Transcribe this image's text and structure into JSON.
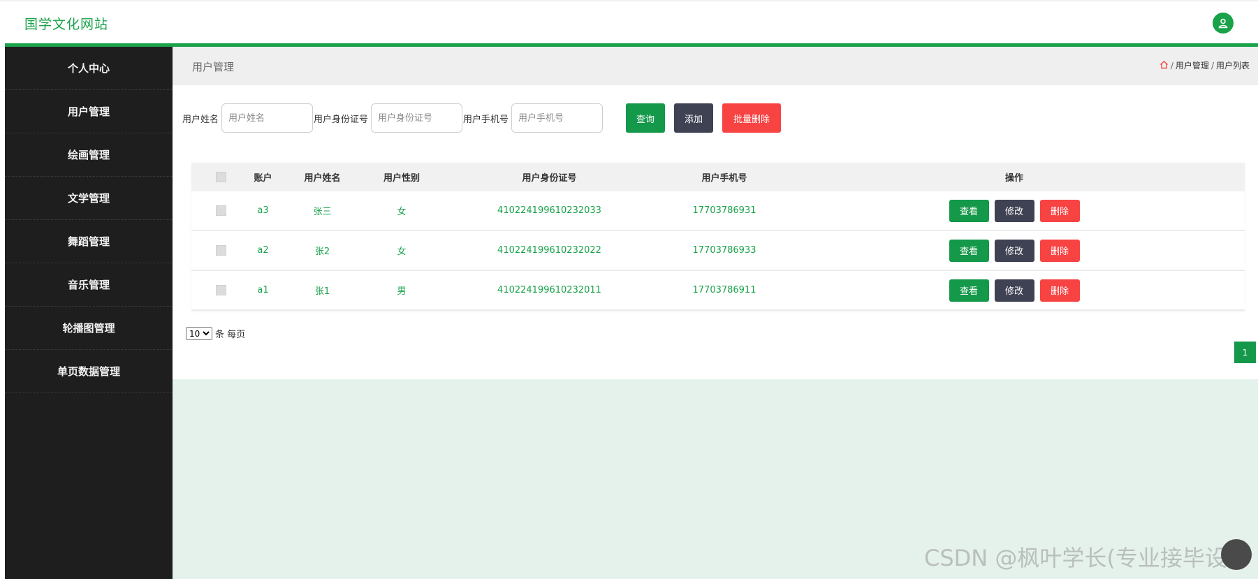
{
  "app": {
    "title": "国学文化网站"
  },
  "colors": {
    "accent": "#19a24a",
    "sidebar": "#1e1e1e",
    "danger": "#f74342",
    "dark": "#3e4253"
  },
  "sidebar": {
    "items": [
      {
        "label": "个人中心"
      },
      {
        "label": "用户管理"
      },
      {
        "label": "绘画管理"
      },
      {
        "label": "文学管理"
      },
      {
        "label": "舞蹈管理"
      },
      {
        "label": "音乐管理"
      },
      {
        "label": "轮播图管理"
      },
      {
        "label": "单页数据管理"
      }
    ]
  },
  "page": {
    "title": "用户管理",
    "breadcrumb": {
      "home_icon": "home-icon",
      "sep": "/",
      "level1": "用户管理",
      "level2": "用户列表"
    }
  },
  "search": {
    "name_label": "用户姓名",
    "name_placeholder": "用户姓名",
    "id_label": "用户身份证号",
    "id_placeholder": "用户身份证号",
    "phone_label": "用户手机号",
    "phone_placeholder": "用户手机号",
    "query_label": "查询",
    "add_label": "添加",
    "batch_delete_label": "批量删除"
  },
  "table": {
    "headers": {
      "account": "账户",
      "name": "用户姓名",
      "sex": "用户性别",
      "id": "用户身份证号",
      "phone": "用户手机号",
      "ops": "操作"
    },
    "rows": [
      {
        "account": "a3",
        "name": "张三",
        "sex": "女",
        "id": "410224199610232033",
        "phone": "17703786931"
      },
      {
        "account": "a2",
        "name": "张2",
        "sex": "女",
        "id": "410224199610232022",
        "phone": "17703786933"
      },
      {
        "account": "a1",
        "name": "张1",
        "sex": "男",
        "id": "410224199610232011",
        "phone": "17703786911"
      }
    ],
    "op_labels": {
      "view": "查看",
      "edit": "修改",
      "delete": "删除"
    }
  },
  "pagination": {
    "page_size": "10",
    "per_page_text": "条 每页",
    "current_page": "1"
  },
  "watermark": "CSDN @枫叶学长(专业接毕设)"
}
